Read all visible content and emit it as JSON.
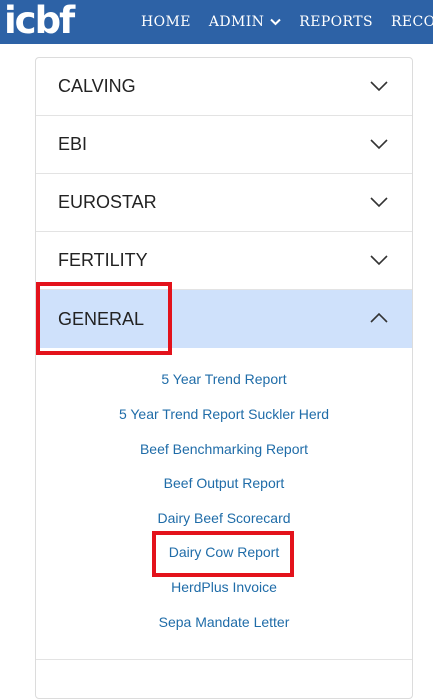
{
  "brand": {
    "logo_text": "icbf"
  },
  "nav": {
    "home": "HOME",
    "admin": "ADMIN",
    "reports": "REPORTS",
    "records": "RECORD"
  },
  "accordion": {
    "sections": [
      "CALVING",
      "EBI",
      "EUROSTAR",
      "FERTILITY",
      "GENERAL"
    ],
    "expanded": "GENERAL",
    "general_items": [
      "5 Year Trend Report",
      "5 Year Trend Report Suckler Herd",
      "Beef Benchmarking Report",
      "Beef Output Report",
      "Dairy Beef Scorecard",
      "Dairy Cow Report",
      "HerdPlus Invoice",
      "Sepa Mandate Letter"
    ]
  },
  "colors": {
    "topbar": "#2d62a6",
    "active_section_bg": "#cfe1fb",
    "link": "#1f6ca8",
    "highlight": "#e3121b"
  },
  "icons": {
    "section_collapsed": "chevron-down-icon",
    "section_expanded": "chevron-up-icon",
    "admin_menu": "chevron-down-icon"
  }
}
